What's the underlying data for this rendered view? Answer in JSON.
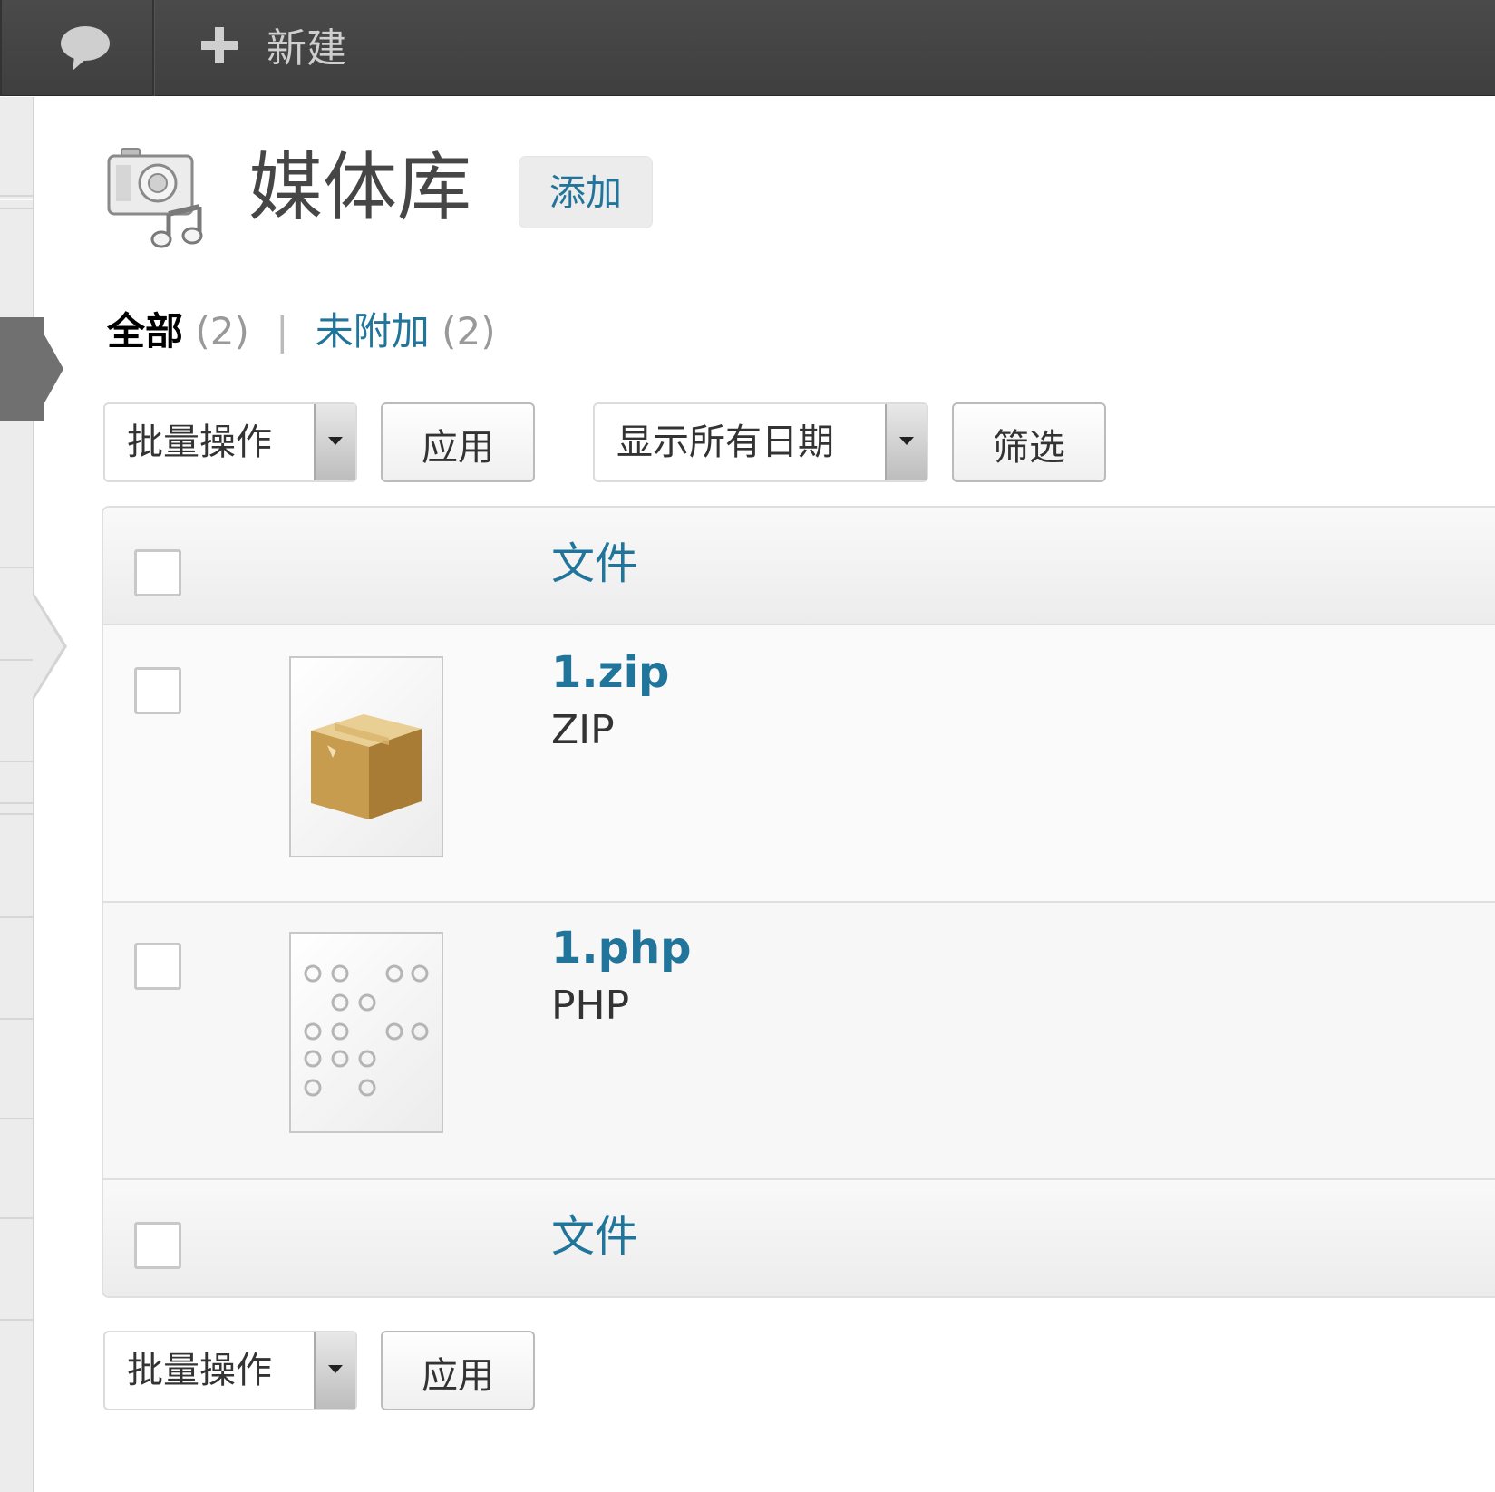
{
  "adminbar": {
    "comments_icon": "speech-bubble-icon",
    "new_icon": "plus-icon",
    "new_label": "新建"
  },
  "header": {
    "icon": "media-library-icon",
    "title": "媒体库",
    "add_new_label": "添加"
  },
  "filters": {
    "all_label": "全部",
    "all_count": "(2)",
    "divider": "|",
    "unattached_label": "未附加",
    "unattached_count": "(2)"
  },
  "top_toolbar": {
    "bulk_actions": "批量操作",
    "apply_label": "应用",
    "date_filter": "显示所有日期",
    "filter_label": "筛选"
  },
  "table": {
    "column_file": "文件",
    "rows": [
      {
        "name": "1.zip",
        "type": "ZIP",
        "thumb_icon": "archive-box-icon"
      },
      {
        "name": "1.php",
        "type": "PHP",
        "thumb_icon": "code-document-icon"
      }
    ]
  },
  "bottom_toolbar": {
    "bulk_actions": "批量操作",
    "apply_label": "应用"
  },
  "colors": {
    "link": "#21759b",
    "adminbar": "#464646",
    "menu_current": "#707070"
  }
}
